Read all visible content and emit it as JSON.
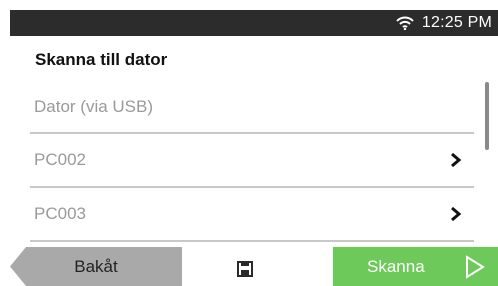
{
  "status": {
    "time": "12:25 PM",
    "icon": "wifi-icon"
  },
  "screen": {
    "title": "Skanna till dator"
  },
  "list": {
    "items": [
      {
        "label": "Dator (via USB)",
        "has_arrow": false
      },
      {
        "label": "PC002",
        "has_arrow": true
      },
      {
        "label": "PC003",
        "has_arrow": true
      }
    ]
  },
  "footer": {
    "back_label": "Bakåt",
    "save_icon": "save-icon",
    "scan_label": "Skanna",
    "scan_icon": "play-icon"
  },
  "colors": {
    "status_bar": "#2c2c2c",
    "back_button": "#a9a9a9",
    "scan_button": "#6dca5a",
    "divider": "#c8c8c8"
  }
}
